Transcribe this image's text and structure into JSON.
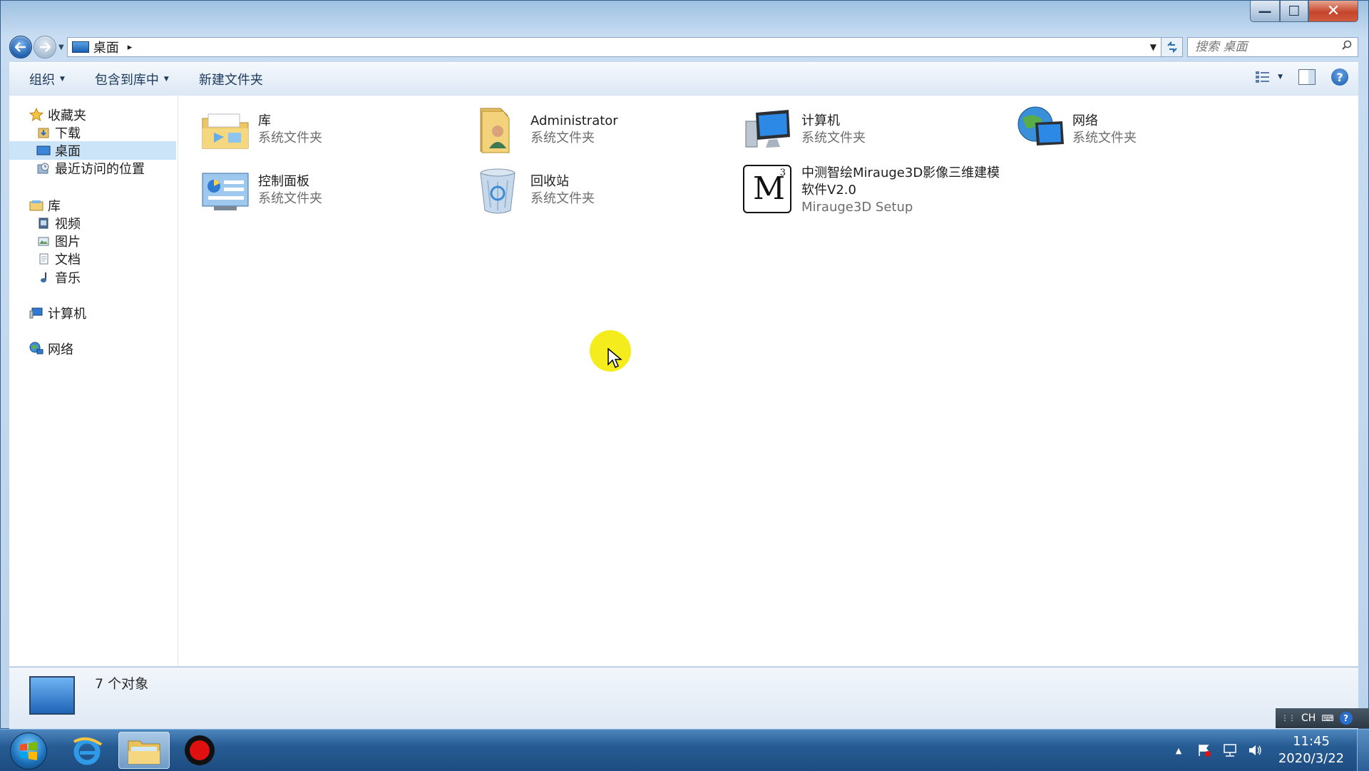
{
  "window": {
    "controls": {
      "minimize": "—",
      "maximize": "☐",
      "close": "✕"
    }
  },
  "address": {
    "crumb": "桌面",
    "arrow": "▸",
    "search_placeholder": "搜索 桌面"
  },
  "toolbar": {
    "organize": "组织",
    "include_library": "包含到库中",
    "new_folder": "新建文件夹"
  },
  "sidebar": {
    "favorites": "收藏夹",
    "downloads": "下载",
    "desktop": "桌面",
    "recent": "最近访问的位置",
    "libraries": "库",
    "videos": "视频",
    "pictures": "图片",
    "documents": "文档",
    "music": "音乐",
    "computer": "计算机",
    "network": "网络"
  },
  "items": [
    {
      "name": "库",
      "sub": "系统文件夹",
      "icon": "library-folder-icon"
    },
    {
      "name": "Administrator",
      "sub": "系统文件夹",
      "icon": "user-folder-icon"
    },
    {
      "name": "计算机",
      "sub": "系统文件夹",
      "icon": "computer-icon"
    },
    {
      "name": "网络",
      "sub": "系统文件夹",
      "icon": "network-icon"
    },
    {
      "name": "控制面板",
      "sub": "系统文件夹",
      "icon": "control-panel-icon"
    },
    {
      "name": "回收站",
      "sub": "系统文件夹",
      "icon": "recycle-bin-icon"
    },
    {
      "name_line1": "中测智绘Mirauge3D影像三维建模",
      "name_line2": "软件V2.0",
      "sub": "Mirauge3D Setup",
      "icon": "mirauge3d-app-icon",
      "logo_letter": "M",
      "logo_super": "3"
    }
  ],
  "details": {
    "count": "7 个对象"
  },
  "language_bar": {
    "lang": "CH",
    "help": "?"
  },
  "taskbar": {
    "clock_time": "11:45",
    "clock_date": "2020/3/22",
    "tray_up": "▲"
  },
  "colors": {
    "selection": "#cce4f7",
    "accent": "#1a58a8",
    "cursor_halo": "#f5ec1d"
  }
}
